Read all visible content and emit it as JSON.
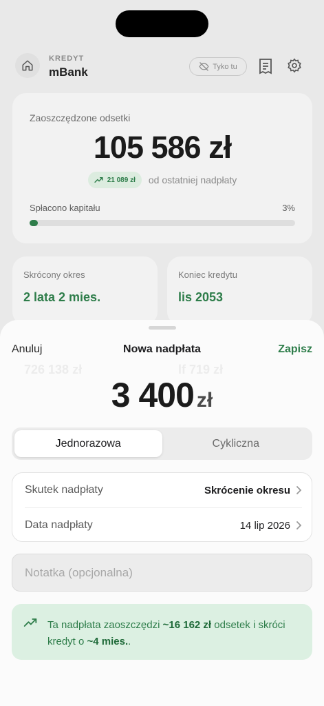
{
  "background": {
    "header": {
      "kicker": "KREDYT",
      "bank_name": "mBank",
      "only_here_label": "Tyko tu"
    },
    "savings": {
      "label": "Zaoszczędzone odsetki",
      "value": "105 586 zł",
      "delta_badge": "21 089 zł",
      "delta_text": "od ostatniej nadpłaty",
      "paid_label": "Spłacono kapitału",
      "paid_pct_text": "3%",
      "paid_fraction": 0.03
    },
    "mini_cards": [
      {
        "label": "Skrócony okres",
        "value": "2 lata 2 mies."
      },
      {
        "label": "Koniec kredytu",
        "value": "lis 2053"
      }
    ],
    "ghost_left": "726 138 zł",
    "ghost_right": "lf 719 zł"
  },
  "sheet": {
    "cancel_label": "Anuluj",
    "title": "Nowa nadpłata",
    "save_label": "Zapisz",
    "amount": "3 400",
    "currency": "zł",
    "segments": [
      "Jednorazowa",
      "Cykliczna"
    ],
    "active_segment": "Jednorazowa",
    "rows": [
      {
        "label": "Skutek nadpłaty",
        "value": "Skrócenie okresu"
      },
      {
        "label": "Data nadpłaty",
        "value": "14 lip 2026"
      }
    ],
    "note_placeholder": "Notatka (opcjonalna)",
    "info": {
      "part1": "Ta nadpłata zaoszczędzi ",
      "amount": "~16 162 zł",
      "part2": " odsetek i skróci kredyt o ",
      "period": "~4 mies.",
      "part3": "."
    }
  },
  "colors": {
    "accent_green": "#2e7d4a",
    "info_bg": "#dcf0e2",
    "background": "#e9e9e9"
  },
  "icons": {
    "home": "home-icon",
    "hidden": "eye-off-icon",
    "receipt": "receipt-icon",
    "settings": "gear-icon",
    "trend": "trending-up-icon",
    "chevron": "chevron-right-icon"
  }
}
